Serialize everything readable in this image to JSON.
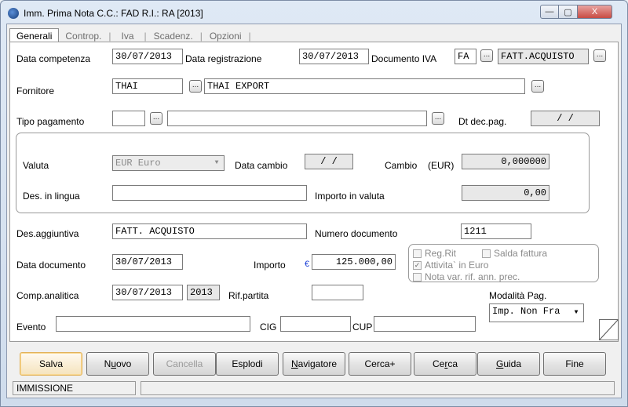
{
  "window": {
    "title": "Imm. Prima Nota C.C.: FAD  R.I.: RA  [2013]",
    "min_glyph": "—",
    "max_glyph": "▢",
    "close_glyph": "X"
  },
  "tabs": [
    {
      "label": "Generali",
      "active": true
    },
    {
      "label": "Controp.",
      "active": false
    },
    {
      "label": "Iva",
      "active": false
    },
    {
      "label": "Scadenz.",
      "active": false
    },
    {
      "label": "Opzioni",
      "active": false
    }
  ],
  "tab_separator": "|",
  "dots_glyph": "...",
  "form": {
    "data_competenza": {
      "label": "Data competenza",
      "value": "30/07/2013"
    },
    "data_registrazione": {
      "label": "Data registrazione",
      "value": "30/07/2013"
    },
    "documento_iva": {
      "label": "Documento IVA",
      "code": "FA",
      "desc": "FATT.ACQUISTO"
    },
    "fornitore": {
      "label": "Fornitore",
      "code": "THAI",
      "desc": "THAI EXPORT"
    },
    "tipo_pagamento": {
      "label": "Tipo pagamento",
      "code": "",
      "desc": ""
    },
    "dt_dec_pag": {
      "label": "Dt dec.pag.",
      "value": "/   /"
    },
    "valuta": {
      "label": "Valuta",
      "value": "EUR Euro"
    },
    "data_cambio": {
      "label": "Data cambio",
      "value": "/   /"
    },
    "cambio": {
      "label": "Cambio",
      "unit": "(EUR)",
      "value": "0,000000"
    },
    "des_in_lingua": {
      "label": "Des. in lingua",
      "value": ""
    },
    "importo_in_valuta": {
      "label": "Importo in valuta",
      "value": "0,00"
    },
    "des_aggiuntiva": {
      "label": "Des.aggiuntiva",
      "value": "FATT. ACQUISTO"
    },
    "numero_documento": {
      "label": "Numero documento",
      "value": "1211"
    },
    "data_documento": {
      "label": "Data documento",
      "value": "30/07/2013"
    },
    "importo": {
      "label": "Importo",
      "currency": "€",
      "value": "125.000,00"
    },
    "reg_rit": {
      "label": "Reg.Rit",
      "checked": false
    },
    "salda_fattura": {
      "label": "Salda fattura",
      "checked": false
    },
    "attivita_euro": {
      "label": "Attivita` in Euro",
      "checked": true,
      "mark": "✓"
    },
    "nota_var": {
      "label": "Nota var. rif. ann. prec.",
      "checked": false
    },
    "comp_analitica": {
      "label": "Comp.analitica",
      "value": "30/07/2013",
      "year": "2013"
    },
    "rif_partita": {
      "label": "Rif.partita",
      "value": ""
    },
    "modalita_pag": {
      "label": "Modalità Pag.",
      "value": "Imp. Non Fra"
    },
    "evento": {
      "label": "Evento",
      "value": ""
    },
    "cig": {
      "label": "CIG",
      "value": ""
    },
    "cup": {
      "label": "CUP",
      "value": ""
    }
  },
  "buttons": {
    "salva": "Salva",
    "nuovo_pre": "N",
    "nuovo_u": "u",
    "nuovo_post": "ovo",
    "cancella": "Cancella",
    "esplodi": "Esplodi",
    "navigatore_u": "N",
    "navigatore_post": "avigatore",
    "cerca_plus": "Cerca+",
    "cerca_pre": "Ce",
    "cerca_u": "r",
    "cerca_post": "ca",
    "guida_u": "G",
    "guida_post": "uida",
    "fine": "Fine"
  },
  "status": {
    "mode": "IMMISSIONE",
    "message": ""
  },
  "colors": {
    "currency_blue": "#1a3fd6",
    "primary_border": "#e2b25a"
  }
}
